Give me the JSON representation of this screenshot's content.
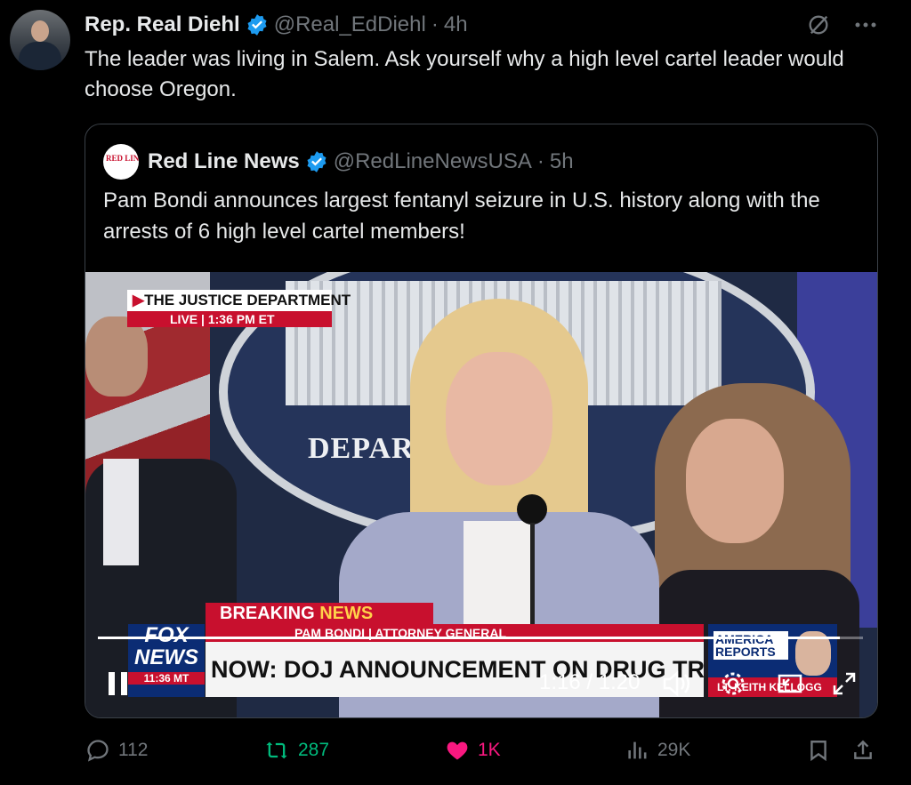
{
  "tweet": {
    "author_name": "Rep. Real Diehl",
    "handle": "@Real_EdDiehl",
    "separator": "·",
    "time": "4h",
    "text": "The leader was living in Salem. Ask yourself why a high level cartel leader would choose Oregon."
  },
  "quote": {
    "logo_text": "RED LINE NEWS",
    "author_name": "Red Line News",
    "handle": "@RedLineNewsUSA",
    "separator": "·",
    "time": "5h",
    "text": "Pam Bondi announces largest fentanyl seizure in U.S. history along with the arrests of 6 high level cartel members!"
  },
  "video": {
    "chyron_top": "THE JUSTICE DEPARTMENT",
    "chyron_live": "LIVE",
    "chyron_time": "1:36 PM ET",
    "backdrop_text": "DEPART    JUSTI",
    "breaking_label_1": "BREAKING ",
    "breaking_label_2": "NEWS",
    "sub_bar": "PAM BONDI | ATTORNEY GENERAL",
    "fox_line1": "FOX",
    "fox_line2": "NEWS",
    "fox_time": "11:36 MT",
    "headline": "NOW: DOJ ANNOUNCEMENT ON DRUG TRAFFICKING OP",
    "america_label": "AMERICA REPORTS",
    "america_bottom": "LT. KEITH KELLOGG",
    "time_display": "1:16 / 1:20",
    "progress": 0.97
  },
  "actions": {
    "replies": "112",
    "reposts": "287",
    "likes": "1K",
    "views": "29K"
  },
  "colors": {
    "verified": "#1d9bf0",
    "repost": "#00ba7c",
    "like": "#f91880",
    "muted": "#71767b"
  }
}
